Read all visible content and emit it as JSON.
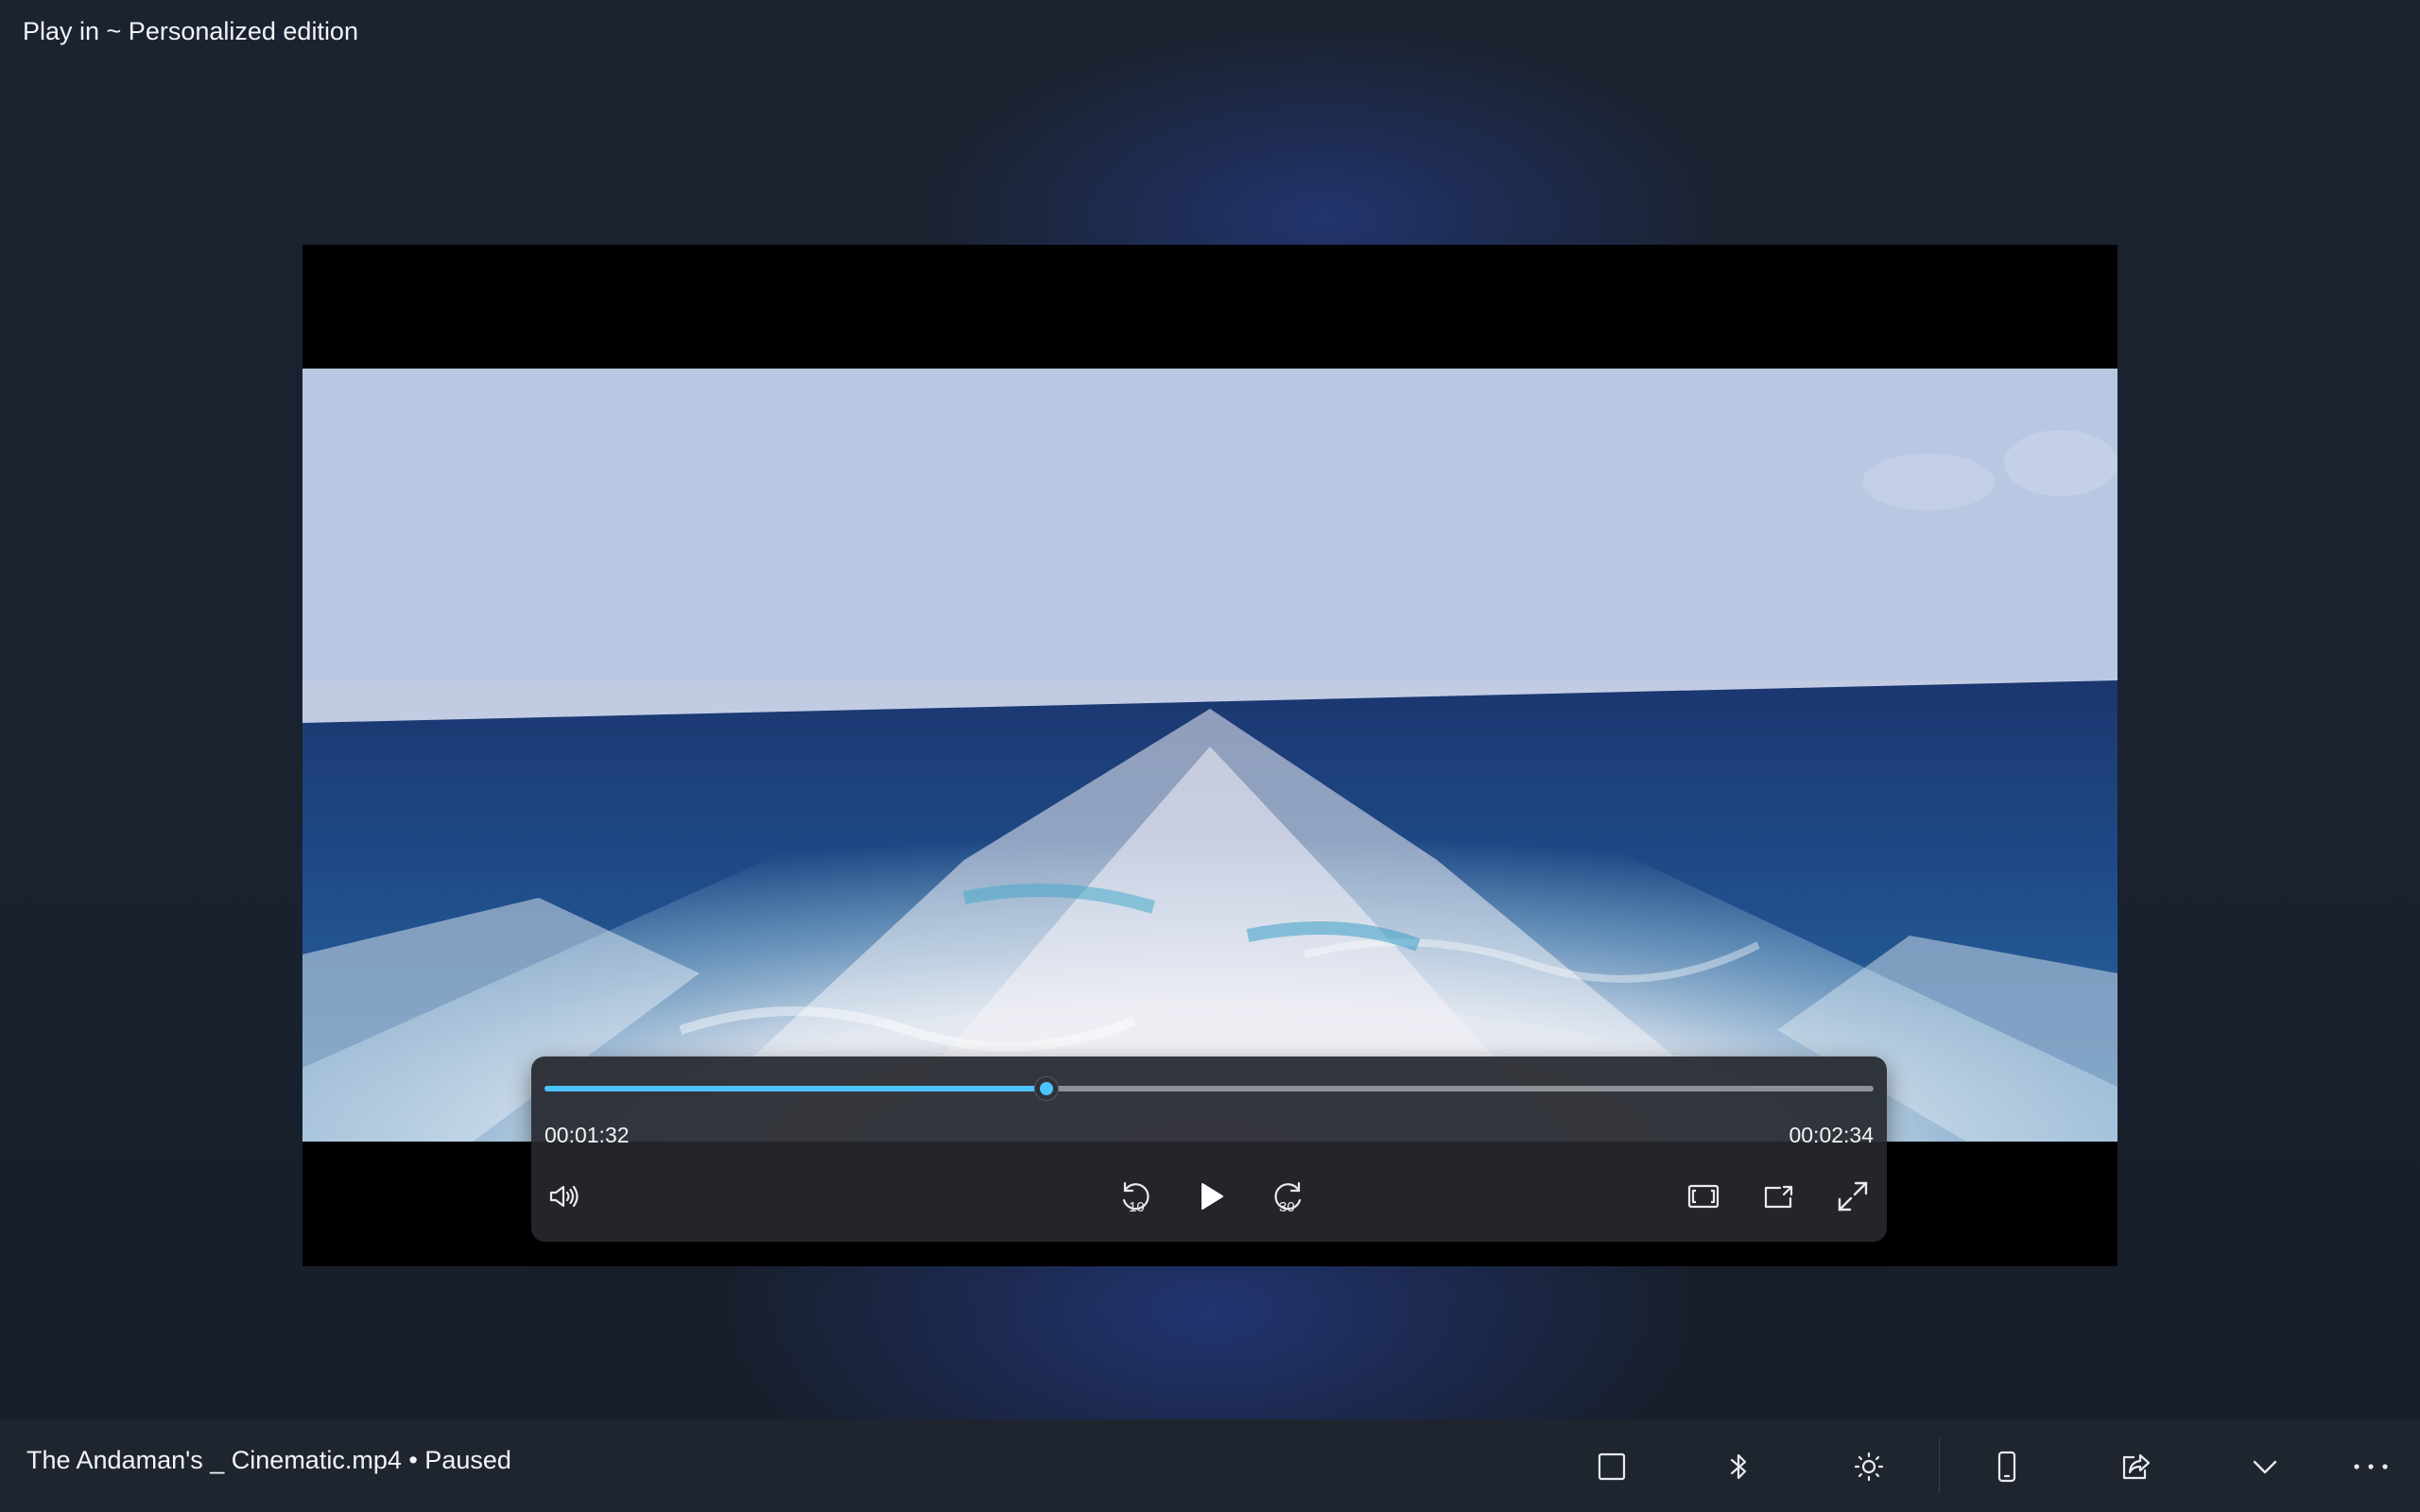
{
  "window": {
    "title": "Play in ~ Personalized edition"
  },
  "player": {
    "progress_fraction": 0.3774,
    "elapsed": "00:01:32",
    "total": "00:02:34",
    "controls": {
      "volume_icon": "volume-icon",
      "rewind_icon": "rewind-10-icon",
      "rewind_label": "10",
      "play_icon": "play-icon",
      "forward_icon": "forward-30-icon",
      "forward_label": "30",
      "aspect_icon": "aspect-ratio-icon",
      "miniplayer_icon": "mini-player-icon",
      "fullscreen_icon": "fullscreen-icon"
    },
    "accent_color": "#4cc2ff"
  },
  "status_bar": {
    "now_playing": "The Andaman's _ Cinematic.mp4 • Paused",
    "buttons": [
      "square-icon",
      "bluetooth-icon",
      "brightness-icon",
      "phone-icon",
      "share-icon",
      "chevron-down-icon",
      "more-icon"
    ]
  }
}
